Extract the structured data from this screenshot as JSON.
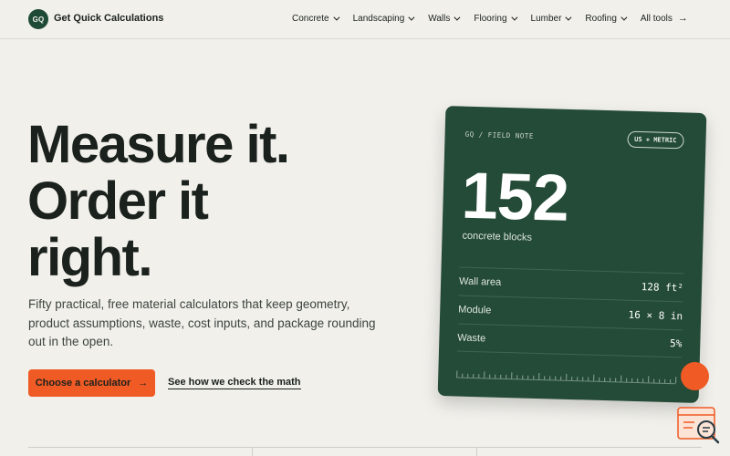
{
  "nav": {
    "logo_text": "GQ",
    "brand": "Get Quick Calculations",
    "items": [
      {
        "label": "Concrete"
      },
      {
        "label": "Landscaping"
      },
      {
        "label": "Walls"
      },
      {
        "label": "Flooring"
      },
      {
        "label": "Lumber"
      },
      {
        "label": "Roofing"
      }
    ],
    "all_tools": "All tools"
  },
  "hero": {
    "title_line1": "Measure it.",
    "title_line2": "Order it",
    "title_line3": "right.",
    "subtitle": "Fifty practical, free material calculators that keep geometry, product assumptions, waste, cost inputs, and package rounding out in the open.",
    "cta_primary": "Choose a calculator",
    "cta_secondary": "See how we check the math"
  },
  "card": {
    "label": "GQ / FIELD NOTE",
    "pill": "US + METRIC",
    "big_number": "152",
    "unit": "concrete blocks",
    "rows": [
      {
        "key": "Wall area",
        "value": "128 ft²"
      },
      {
        "key": "Module",
        "value": "16 × 8 in"
      },
      {
        "key": "Waste",
        "value": "5%"
      }
    ]
  },
  "colors": {
    "accent": "#f05a24",
    "brand_green": "#244b37",
    "background": "#f1f0eb"
  }
}
